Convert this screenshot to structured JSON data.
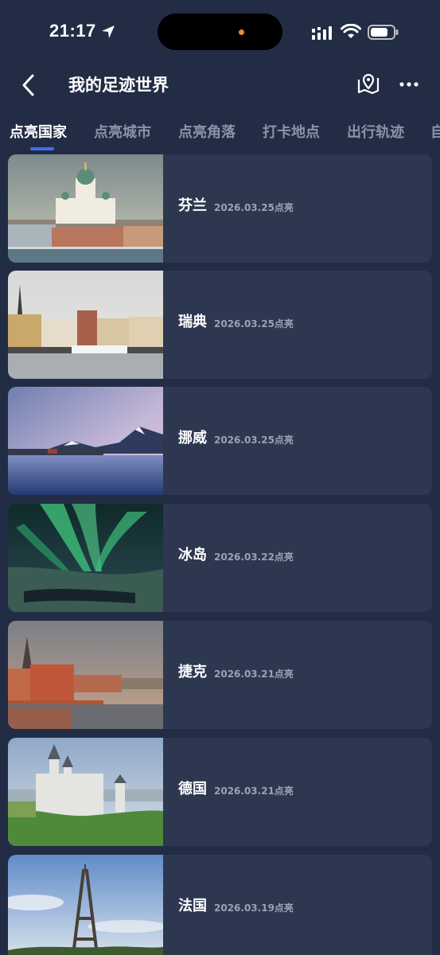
{
  "status_bar": {
    "time": "21:17"
  },
  "nav": {
    "title": "我的足迹世界"
  },
  "tabs": [
    {
      "label": "点亮国家",
      "active": true
    },
    {
      "label": "点亮城市",
      "active": false
    },
    {
      "label": "点亮角落",
      "active": false
    },
    {
      "label": "打卡地点",
      "active": false
    },
    {
      "label": "出行轨迹",
      "active": false
    },
    {
      "label": "自",
      "active": false
    }
  ],
  "countries": [
    {
      "name": "芬兰",
      "date": "2026.03.25点亮",
      "image": "helsinki-cathedral-photo"
    },
    {
      "name": "瑞典",
      "date": "2026.03.25点亮",
      "image": "stockholm-waterfront-photo"
    },
    {
      "name": "挪威",
      "date": "2026.03.25点亮",
      "image": "norway-fjord-photo"
    },
    {
      "name": "冰岛",
      "date": "2026.03.22点亮",
      "image": "iceland-aurora-photo"
    },
    {
      "name": "捷克",
      "date": "2026.03.21点亮",
      "image": "prague-riverside-photo"
    },
    {
      "name": "德国",
      "date": "2026.03.21点亮",
      "image": "neuschwanstein-castle-photo"
    },
    {
      "name": "法国",
      "date": "2026.03.19点亮",
      "image": "eiffel-tower-photo"
    }
  ],
  "colors": {
    "background": "#222c44",
    "card": "#2d3750",
    "accent": "#3f6ef0",
    "tab_inactive": "#8a93a8"
  }
}
